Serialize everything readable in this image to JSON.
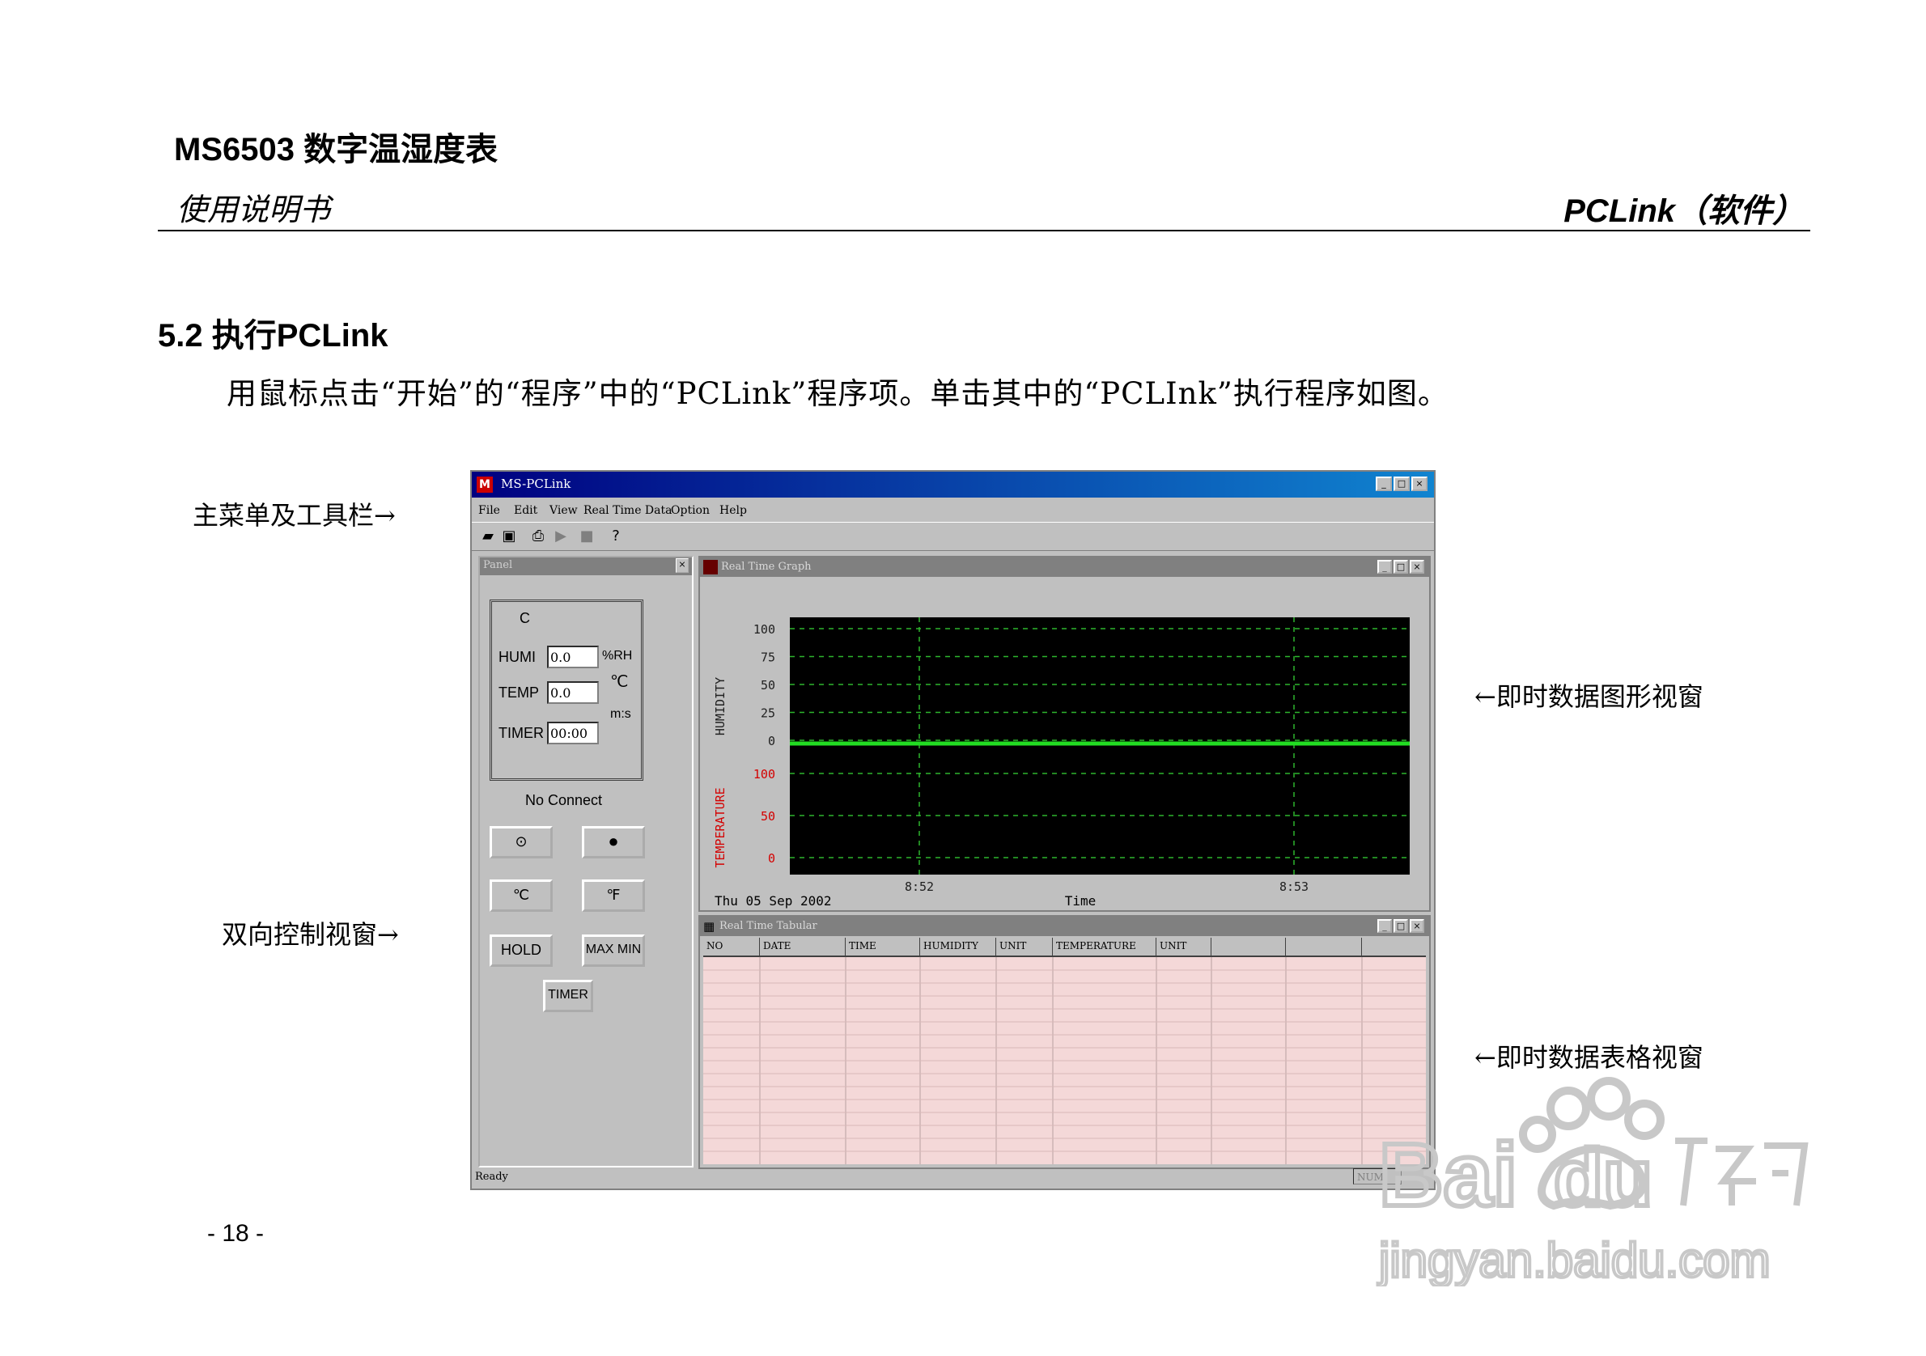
{
  "header": {
    "title": "MS6503 数字温湿度表",
    "subtitle": "使用说明书",
    "right": "PCLink（软件）"
  },
  "section": {
    "title": "5.2  执行PCLink",
    "paragraph": "用鼠标点击“开始”的“程序”中的“PCLink”程序项。单击其中的“PCLInk”执行程序如图。"
  },
  "notes": {
    "menu": "主菜单及工具栏→",
    "control": "双向控制视窗→",
    "graph": "←即时数据图形视窗",
    "table": "←即时数据表格视窗"
  },
  "page_number": "- 18 -",
  "window": {
    "title": "MS-PCLink",
    "icon": "M",
    "menus": [
      "File",
      "Edit",
      "View",
      "Real Time Data",
      "Option",
      "Help"
    ],
    "toolbar_icons": [
      "open-icon",
      "save-icon",
      "print-icon",
      "play-icon",
      "stop-icon",
      "help-icon"
    ],
    "status": "Ready",
    "status_right": "NUM"
  },
  "panel": {
    "title": "Panel",
    "group_label": "C",
    "humi_label": "HUMI",
    "humi_value": "0.0",
    "humi_unit": "%RH",
    "temp_label": "TEMP",
    "temp_value": "0.0",
    "temp_unit": "℃",
    "timer_label": "TIMER",
    "timer_value": "00:00",
    "timer_unit": "m:s",
    "connection": "No Connect",
    "btn_celsius": "℃",
    "btn_fahrenheit": "℉",
    "btn_hold": "HOLD",
    "btn_maxmin": "MAX MIN",
    "btn_timer": "TIMER"
  },
  "graph_window": {
    "title": "Real Time Graph",
    "date_label": "Thu 05 Sep 2002",
    "colors": {
      "plot_bg": "#000000",
      "grid": "#2db52d",
      "line": "#22dd22",
      "temp_axis": "#d40000",
      "humi_axis": "#202020"
    }
  },
  "table_window": {
    "title": "Real Time Tabular",
    "columns": [
      "NO",
      "DATE",
      "TIME",
      "HUMIDITY",
      "UNIT",
      "TEMPERATURE",
      "UNIT",
      "",
      "",
      ""
    ]
  },
  "chart_data": {
    "type": "line",
    "xlabel": "Time",
    "x_ticks": [
      "8:52",
      "8:53"
    ],
    "humidity_axis": {
      "label": "HUMIDITY",
      "ticks": [
        100,
        75,
        50,
        25,
        0
      ]
    },
    "temperature_axis": {
      "label": "TEMPERATURE",
      "ticks": [
        100,
        50,
        0
      ]
    },
    "series": [
      {
        "values": [
          0,
          0
        ]
      }
    ],
    "grid": true
  }
}
